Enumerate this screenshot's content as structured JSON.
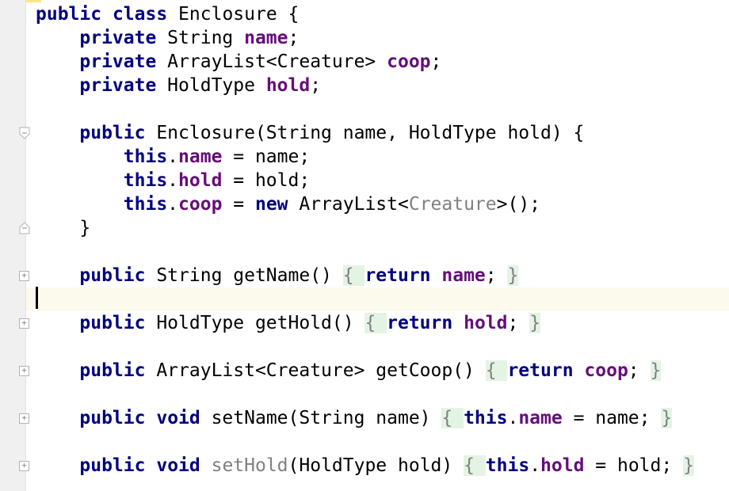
{
  "editor": {
    "lines": [
      {
        "id": "l0",
        "tokens": [
          [
            "kw",
            "public"
          ],
          [
            "plain",
            " "
          ],
          [
            "kw",
            "class"
          ],
          [
            "plain",
            " Enclosure {"
          ]
        ]
      },
      {
        "id": "l1",
        "tokens": [
          [
            "plain",
            "    "
          ],
          [
            "kw",
            "private"
          ],
          [
            "plain",
            " String "
          ],
          [
            "fld",
            "name"
          ],
          [
            "plain",
            ";"
          ]
        ]
      },
      {
        "id": "l2",
        "tokens": [
          [
            "plain",
            "    "
          ],
          [
            "kw",
            "private"
          ],
          [
            "plain",
            " ArrayList<Creature> "
          ],
          [
            "fld",
            "coop"
          ],
          [
            "plain",
            ";"
          ]
        ]
      },
      {
        "id": "l3",
        "tokens": [
          [
            "plain",
            "    "
          ],
          [
            "kw",
            "private"
          ],
          [
            "plain",
            " HoldType "
          ],
          [
            "fld",
            "hold"
          ],
          [
            "plain",
            ";"
          ]
        ]
      },
      {
        "id": "l4",
        "tokens": []
      },
      {
        "id": "l5",
        "tokens": [
          [
            "plain",
            "    "
          ],
          [
            "kw",
            "public"
          ],
          [
            "plain",
            " Enclosure(String name, HoldType hold) {"
          ]
        ]
      },
      {
        "id": "l6",
        "tokens": [
          [
            "plain",
            "        "
          ],
          [
            "kw",
            "this"
          ],
          [
            "plain",
            "."
          ],
          [
            "fld",
            "name"
          ],
          [
            "plain",
            " = name;"
          ]
        ]
      },
      {
        "id": "l7",
        "tokens": [
          [
            "plain",
            "        "
          ],
          [
            "kw",
            "this"
          ],
          [
            "plain",
            "."
          ],
          [
            "fld",
            "hold"
          ],
          [
            "plain",
            " = hold;"
          ]
        ]
      },
      {
        "id": "l8",
        "tokens": [
          [
            "plain",
            "        "
          ],
          [
            "kw",
            "this"
          ],
          [
            "plain",
            "."
          ],
          [
            "fld",
            "coop"
          ],
          [
            "plain",
            " = "
          ],
          [
            "kw",
            "new"
          ],
          [
            "plain",
            " ArrayList<"
          ],
          [
            "gray",
            "Creature"
          ],
          [
            "plain",
            ">();"
          ]
        ]
      },
      {
        "id": "l9",
        "tokens": [
          [
            "plain",
            "    }"
          ]
        ]
      },
      {
        "id": "l10",
        "tokens": []
      },
      {
        "id": "l11",
        "tokens": [
          [
            "plain",
            "    "
          ],
          [
            "kw",
            "public"
          ],
          [
            "plain",
            " String getName() "
          ],
          [
            "foldopen",
            "{ "
          ],
          [
            "kw",
            "return"
          ],
          [
            "plain",
            " "
          ],
          [
            "fld",
            "name"
          ],
          [
            "plain",
            "; "
          ],
          [
            "foldclose",
            "}"
          ]
        ]
      },
      {
        "id": "l12",
        "tokens": [],
        "current": true
      },
      {
        "id": "l13",
        "tokens": [
          [
            "plain",
            "    "
          ],
          [
            "kw",
            "public"
          ],
          [
            "plain",
            " HoldType getHold() "
          ],
          [
            "foldopen",
            "{ "
          ],
          [
            "kw",
            "return"
          ],
          [
            "plain",
            " "
          ],
          [
            "fld",
            "hold"
          ],
          [
            "plain",
            "; "
          ],
          [
            "foldclose",
            "}"
          ]
        ]
      },
      {
        "id": "l14",
        "tokens": []
      },
      {
        "id": "l15",
        "tokens": [
          [
            "plain",
            "    "
          ],
          [
            "kw",
            "public"
          ],
          [
            "plain",
            " ArrayList<Creature> getCoop() "
          ],
          [
            "foldopen",
            "{ "
          ],
          [
            "kw",
            "return"
          ],
          [
            "plain",
            " "
          ],
          [
            "fld",
            "coop"
          ],
          [
            "plain",
            "; "
          ],
          [
            "foldclose",
            "}"
          ]
        ]
      },
      {
        "id": "l16",
        "tokens": []
      },
      {
        "id": "l17",
        "tokens": [
          [
            "plain",
            "    "
          ],
          [
            "kw",
            "public"
          ],
          [
            "plain",
            " "
          ],
          [
            "kw",
            "void"
          ],
          [
            "plain",
            " setName(String name) "
          ],
          [
            "foldopen",
            "{ "
          ],
          [
            "kw",
            "this"
          ],
          [
            "plain",
            "."
          ],
          [
            "fld",
            "name"
          ],
          [
            "plain",
            " = name; "
          ],
          [
            "foldclose",
            "}"
          ]
        ]
      },
      {
        "id": "l18",
        "tokens": []
      },
      {
        "id": "l19",
        "tokens": [
          [
            "plain",
            "    "
          ],
          [
            "kw",
            "public"
          ],
          [
            "plain",
            " "
          ],
          [
            "kw",
            "void"
          ],
          [
            "plain",
            " "
          ],
          [
            "gray",
            "setHold"
          ],
          [
            "plain",
            "(HoldType hold) "
          ],
          [
            "foldopen",
            "{ "
          ],
          [
            "kw",
            "this"
          ],
          [
            "plain",
            "."
          ],
          [
            "fld",
            "hold"
          ],
          [
            "plain",
            " = hold; "
          ],
          [
            "foldclose",
            "}"
          ]
        ]
      }
    ],
    "fold_markers": [
      {
        "line": 5,
        "kind": "fold-start"
      },
      {
        "line": 9,
        "kind": "fold-end"
      },
      {
        "line": 11,
        "kind": "expand"
      },
      {
        "line": 13,
        "kind": "expand"
      },
      {
        "line": 15,
        "kind": "expand"
      },
      {
        "line": 17,
        "kind": "expand"
      },
      {
        "line": 19,
        "kind": "expand"
      }
    ],
    "colors": {
      "keyword": "#000080",
      "field": "#660e7a",
      "unused": "#808080",
      "current_line": "#fcfaed",
      "folded_region": "#e4f4e4"
    }
  }
}
